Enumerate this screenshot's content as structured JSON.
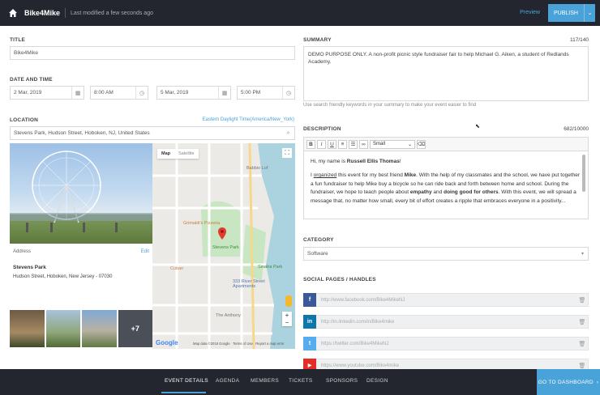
{
  "topbar": {
    "app_title": "Bike4Mike",
    "modified": "Last modified a few seconds ago",
    "preview": "Preview",
    "publish": "PUBLISH"
  },
  "title": {
    "label": "TITLE",
    "value": "Bike4Mike"
  },
  "date_time": {
    "label": "DATE AND TIME",
    "start_date": "2 Mar, 2019",
    "start_time": "8:00 AM",
    "end_date": "5 Mar, 2019",
    "end_time": "5:00 PM"
  },
  "location": {
    "label": "LOCATION",
    "timezone": "Eastern Daylight Time(America/New_York)",
    "value": "Stevens Park, Hudson Street, Hoboken, NJ, United States",
    "address_label": "Address",
    "edit": "Edit",
    "place_name": "Stevens Park",
    "place_address": "Hudson Street, Hoboken, New Jersey - 07030",
    "more_photos": "+7",
    "map_tab": "Map",
    "satellite_tab": "Satellite",
    "map_labels": {
      "babbio": "Babbio Lof",
      "grimaldis": "Grimaldi's Pizzeria",
      "stevens_park": "Stevens Park",
      "sinatra": "Sinatra Park",
      "river_st": "333 River Street Apartments",
      "anthony": "The Anthony",
      "cuban": "Cuban",
      "google": "Google",
      "footer": "Map data ©2018 Google   Terms of Use   Report a map error"
    }
  },
  "summary": {
    "label": "SUMMARY",
    "counter": "117/140",
    "value": "DEMO PURPOSE ONLY. A non-profit picnic style fundraiser fair to help Michael G. Aiken, a student of Redlands Academy.",
    "hint": "Use search friendly keywords in your summary to make your event easier to find"
  },
  "description": {
    "label": "DESCRIPTION",
    "counter": "682/10000",
    "toolbar": {
      "bold": "B",
      "italic": "I",
      "underline": "U",
      "font_size": "Small"
    },
    "greeting": "Hi, my name is",
    "greeting_name": "Russell Ellis Thomas",
    "greeting_end": "!",
    "p1_a": "I",
    "p1_b": "organized",
    "p1_c": "this event for my best friend",
    "p1_d": "Mike",
    "p1_e": ". With the help of my classmates and the school, we have put together a fun fundraiser to help Mike buy a bicycle so he can ride back and forth between home and school. During the fundraiser, we hope to teach people about",
    "p1_f": "empathy",
    "p1_g": "and",
    "p1_h": "doing good for others",
    "p1_i": ". With this event, we will spread a message that, no matter how small, every bit of effort creates a ripple that embraces everyone in a positivity..."
  },
  "category": {
    "label": "CATEGORY",
    "value": "Software"
  },
  "social": {
    "label": "SOCIAL PAGES / HANDLES",
    "items": [
      {
        "letter": "f",
        "color": "#3b5998",
        "url": "http://www.facebook.com/Bike4MikeNJ"
      },
      {
        "letter": "in",
        "color": "#0e76a8",
        "url": "http://in.linkedin.com/in/Bike4mike"
      },
      {
        "letter": "t",
        "color": "#55acee",
        "url": "https://twitter.com/Bike4MikeNJ"
      },
      {
        "letter": "▶",
        "color": "#e52d27",
        "url": "https://www.youtube.com/Bike4mike"
      }
    ]
  },
  "bottom_tabs": [
    "EVENT DETAILS",
    "AGENDA",
    "MEMBERS",
    "TICKETS",
    "SPONSORS",
    "DESIGN"
  ],
  "dashboard_button": "GO TO DASHBOARD"
}
